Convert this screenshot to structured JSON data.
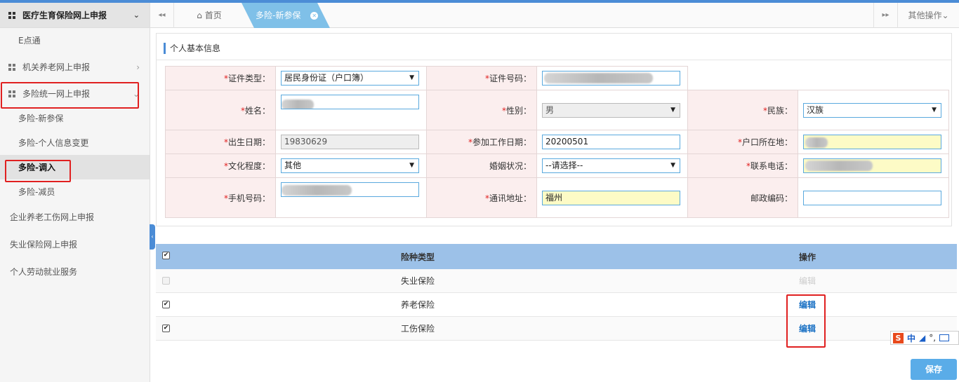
{
  "sidebar": {
    "header": "医疗生育保险网上申报",
    "items": [
      {
        "label": "E点通"
      },
      {
        "label": "机关养老网上申报"
      },
      {
        "label": "多险统一网上申报"
      },
      {
        "label": "多险-新参保"
      },
      {
        "label": "多险-个人信息变更"
      },
      {
        "label": "多险-调入"
      },
      {
        "label": "多险-减员"
      },
      {
        "label": "企业养老工伤网上申报"
      },
      {
        "label": "失业保险网上申报"
      },
      {
        "label": "个人劳动就业服务"
      }
    ]
  },
  "tabs": {
    "home": "首页",
    "active": "多险-新参保",
    "other_ops": "其他操作"
  },
  "form": {
    "title": "个人基本信息",
    "id_type_label": "证件类型：",
    "id_type_value": "居民身份证（户口簿）",
    "id_no_label": "证件号码：",
    "name_label": "姓名：",
    "gender_label": "性别：",
    "gender_value": "男",
    "ethnicity_label": "民族：",
    "ethnicity_value": "汉族",
    "birth_label": "出生日期：",
    "birth_value": "19830629",
    "work_date_label": "参加工作日期：",
    "work_date_value": "20200501",
    "hukou_label": "户口所在地：",
    "education_label": "文化程度：",
    "education_value": "其他",
    "marital_label": "婚姻状况：",
    "marital_value": "--请选择--",
    "phone_label": "联系电话：",
    "mobile_label": "手机号码：",
    "address_label": "通讯地址：",
    "address_value": "福州",
    "postcode_label": "邮政编码：",
    "postcode_value": ""
  },
  "insurance": {
    "col_type": "险种类型",
    "col_op": "操作",
    "rows": [
      {
        "type": "失业保险",
        "op": "编辑",
        "checked": false,
        "enabled": false
      },
      {
        "type": "养老保险",
        "op": "编辑",
        "checked": true,
        "enabled": true
      },
      {
        "type": "工伤保险",
        "op": "编辑",
        "checked": true,
        "enabled": true
      }
    ]
  },
  "save_label": "保存",
  "ime": {
    "lang": "中",
    "punct": "°,"
  },
  "colors": {
    "accent": "#4b8cd6",
    "tab_active": "#7fc0e8",
    "label_bg": "#fbeeee",
    "highlight": "#e02020"
  }
}
